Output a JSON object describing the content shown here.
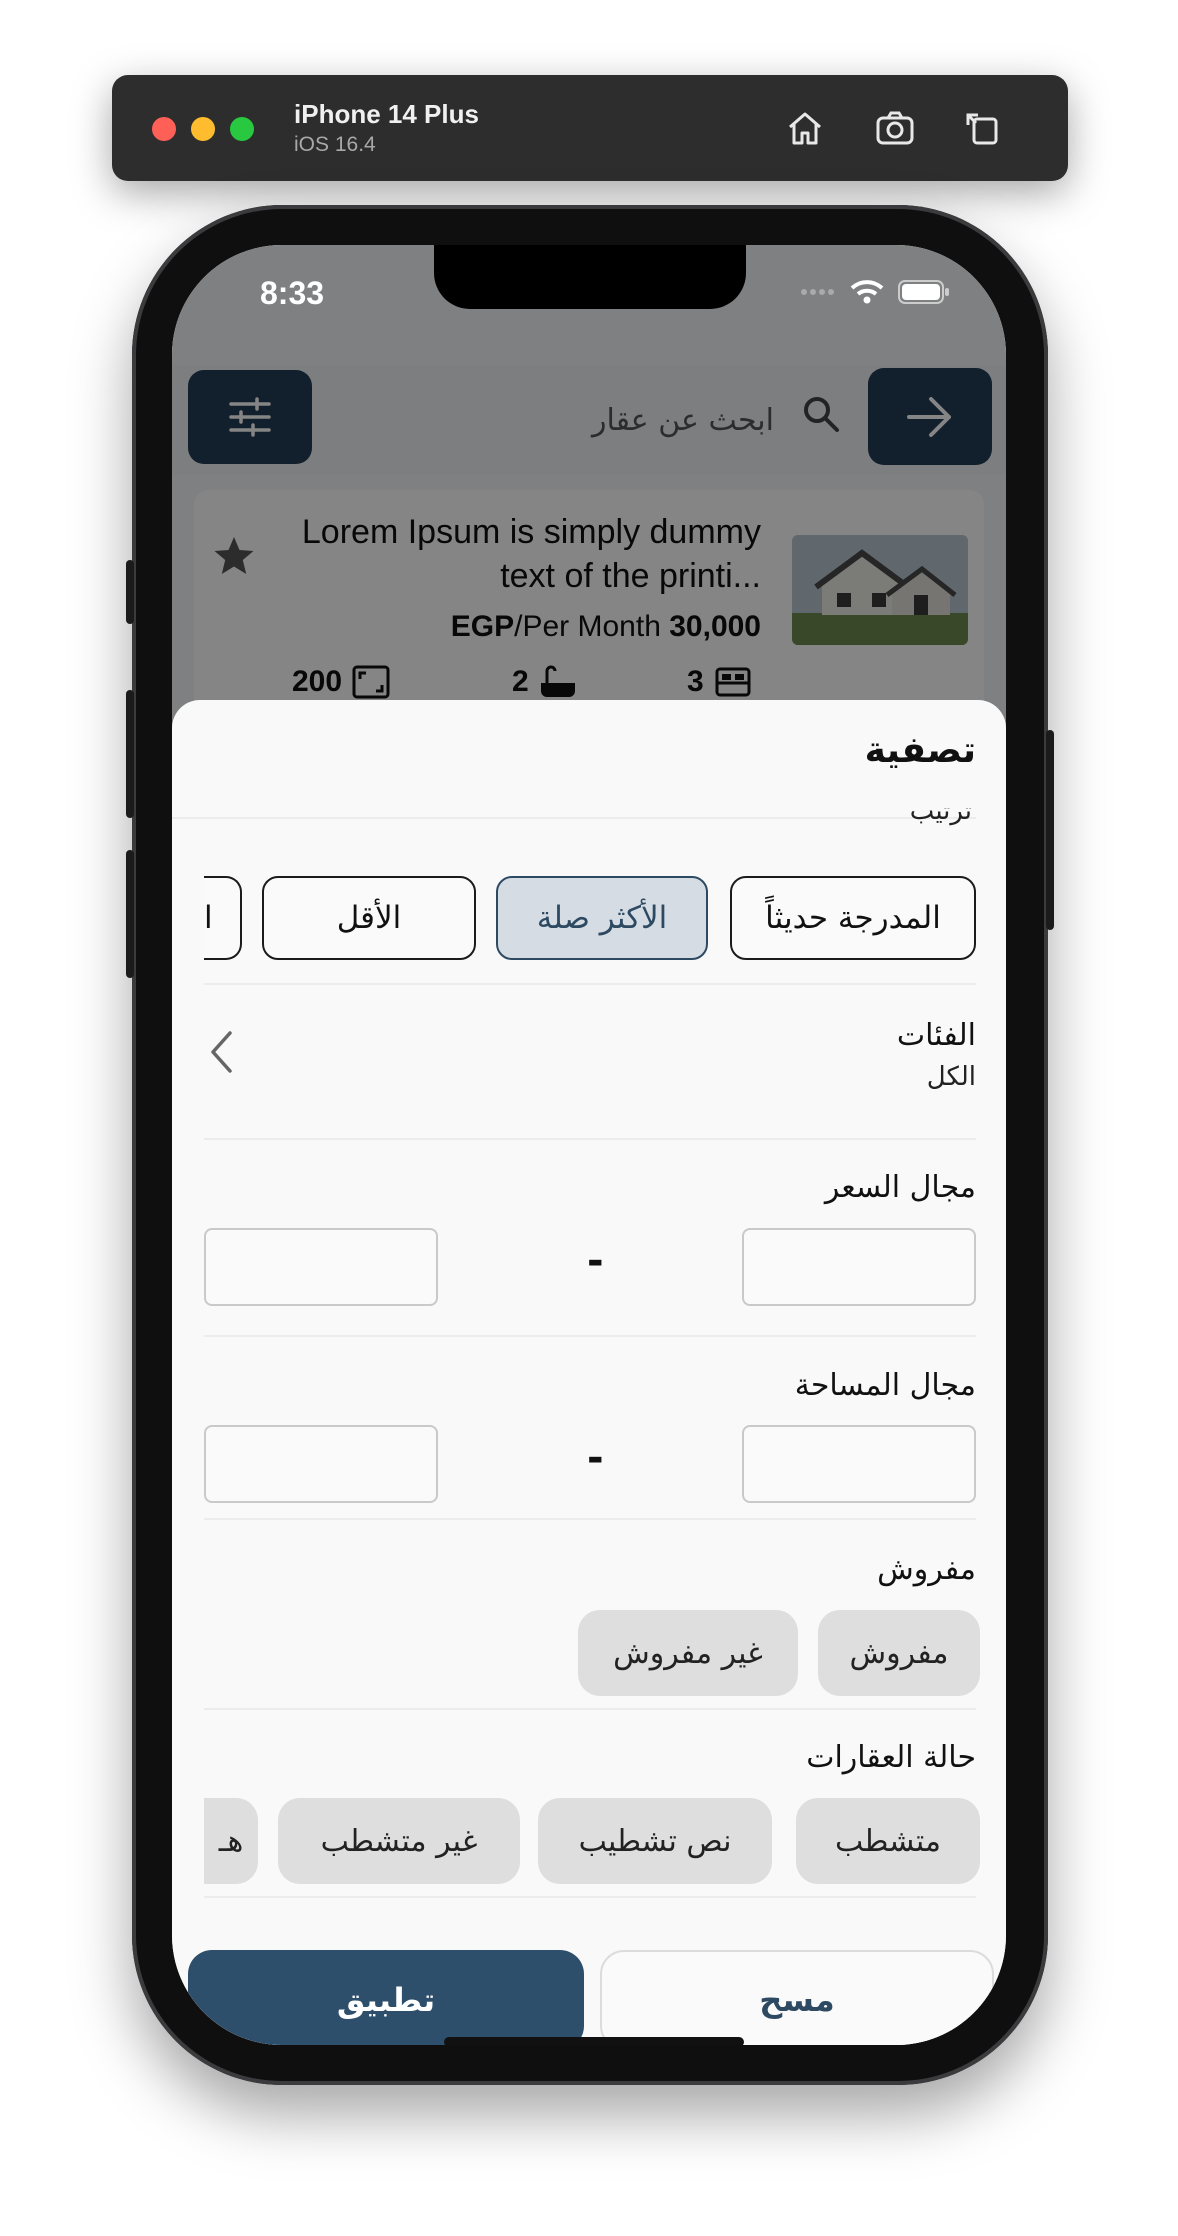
{
  "simulator": {
    "device": "iPhone 14 Plus",
    "os": "iOS 16.4",
    "icons": [
      "home-icon",
      "screenshot-icon",
      "rotate-icon"
    ]
  },
  "status_bar": {
    "time": "8:33"
  },
  "background_app": {
    "search": {
      "placeholder": "ابحث عن عقار"
    },
    "listing": {
      "title": "Lorem Ipsum is simply dummy text of the printi...",
      "price_amount": "30,000",
      "price_unit": "EGP",
      "price_period": "/Per Month",
      "area": "200",
      "bathrooms": "2",
      "bedrooms": "3"
    }
  },
  "filter_sheet": {
    "title": "تصفية",
    "sort_partial_label": "ترتيب",
    "sort_options": [
      {
        "label": "المدرجة حديثاً",
        "active": false
      },
      {
        "label": "الأكثر صلة",
        "active": true
      },
      {
        "label": "الأقل",
        "active": false
      },
      {
        "label": "ا",
        "active": false
      }
    ],
    "categories": {
      "label": "الفئات",
      "value": "الكل"
    },
    "price_range": {
      "label": "مجال السعر",
      "separator": "-"
    },
    "area_range": {
      "label": "مجال المساحة",
      "separator": "-"
    },
    "furnished": {
      "label": "مفروش",
      "options": [
        "مفروش",
        "غير مفروش"
      ]
    },
    "property_status": {
      "label": "حالة العقارات",
      "options": [
        "متشطب",
        "نص تشطيب",
        "غير متشطب",
        "هـ"
      ]
    },
    "actions": {
      "apply": "تطبيق",
      "clear": "مسح"
    }
  },
  "colors": {
    "primary": "#2e4f6b",
    "navy": "#233d55",
    "active_chip_bg": "#d5dce3",
    "pill_bg": "#dedede"
  }
}
